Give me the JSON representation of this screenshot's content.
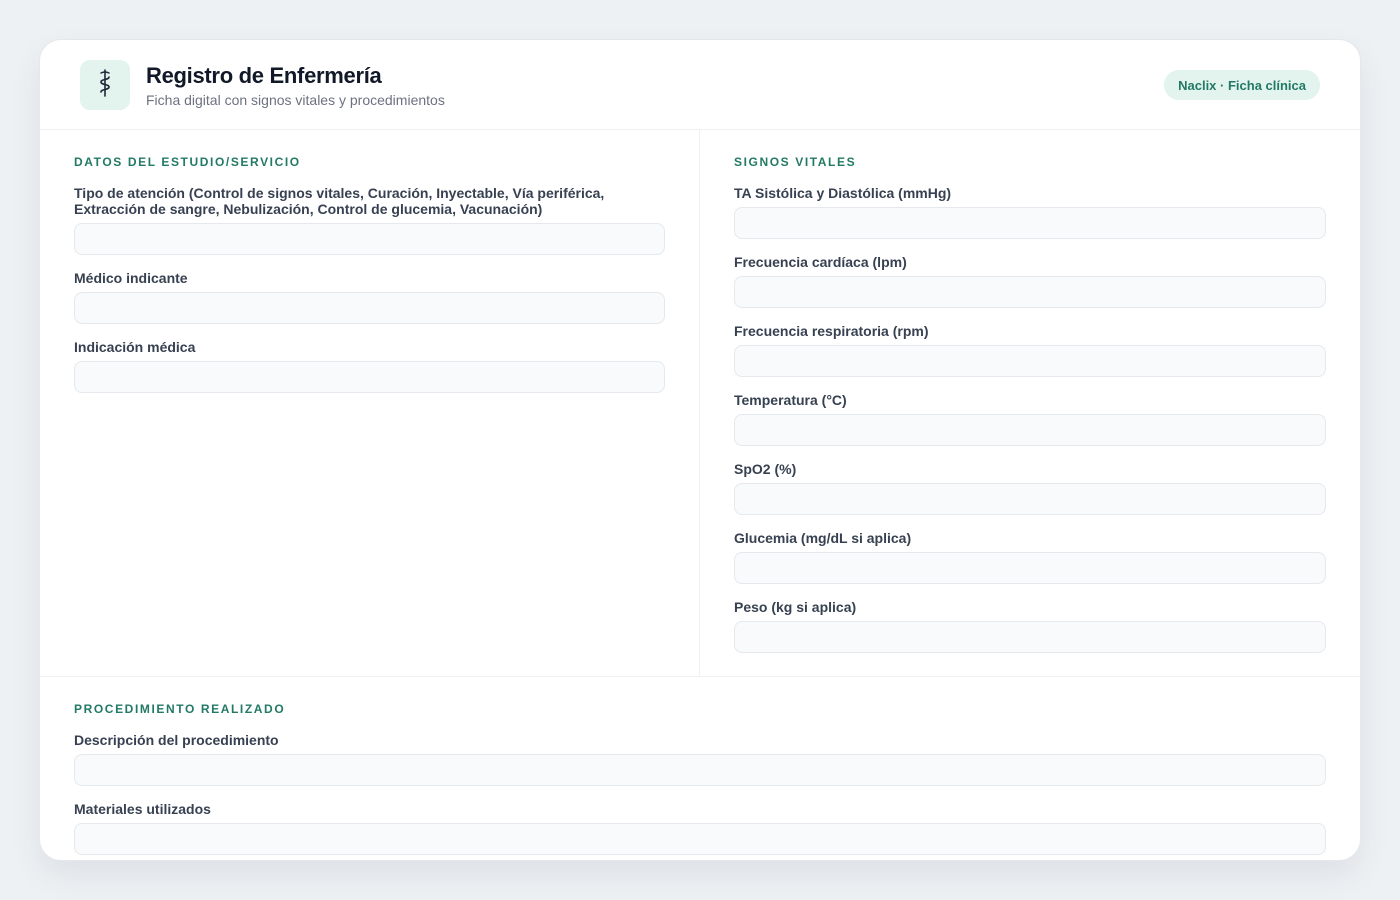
{
  "header": {
    "title": "Registro de Enfermería",
    "subtitle": "Ficha digital con signos vitales y procedimientos",
    "badge": "Naclix · Ficha clínica",
    "logo_icon": "caduceus-icon",
    "accent_color": "#227a64"
  },
  "study_section": {
    "title": "DATOS DEL ESTUDIO/SERVICIO",
    "fields": [
      {
        "label": "Tipo de atención (Control de signos vitales, Curación, Inyectable, Vía periférica, Extracción de sangre, Nebulización, Control de glucemia, Vacunación)",
        "value": ""
      },
      {
        "label": "Médico indicante",
        "value": ""
      },
      {
        "label": "Indicación médica",
        "value": ""
      }
    ]
  },
  "vitals_section": {
    "title": "SIGNOS VITALES",
    "fields": [
      {
        "label": "TA Sistólica y Diastólica (mmHg)",
        "value": ""
      },
      {
        "label": "Frecuencia cardíaca (lpm)",
        "value": ""
      },
      {
        "label": "Frecuencia respiratoria (rpm)",
        "value": ""
      },
      {
        "label": "Temperatura (°C)",
        "value": ""
      },
      {
        "label": "SpO2 (%)",
        "value": ""
      },
      {
        "label": "Glucemia (mg/dL si aplica)",
        "value": ""
      },
      {
        "label": "Peso (kg si aplica)",
        "value": ""
      }
    ]
  },
  "procedure_section": {
    "title": "PROCEDIMIENTO REALIZADO",
    "fields": [
      {
        "label": "Descripción del procedimiento",
        "value": ""
      },
      {
        "label": "Materiales utilizados",
        "value": ""
      }
    ]
  }
}
